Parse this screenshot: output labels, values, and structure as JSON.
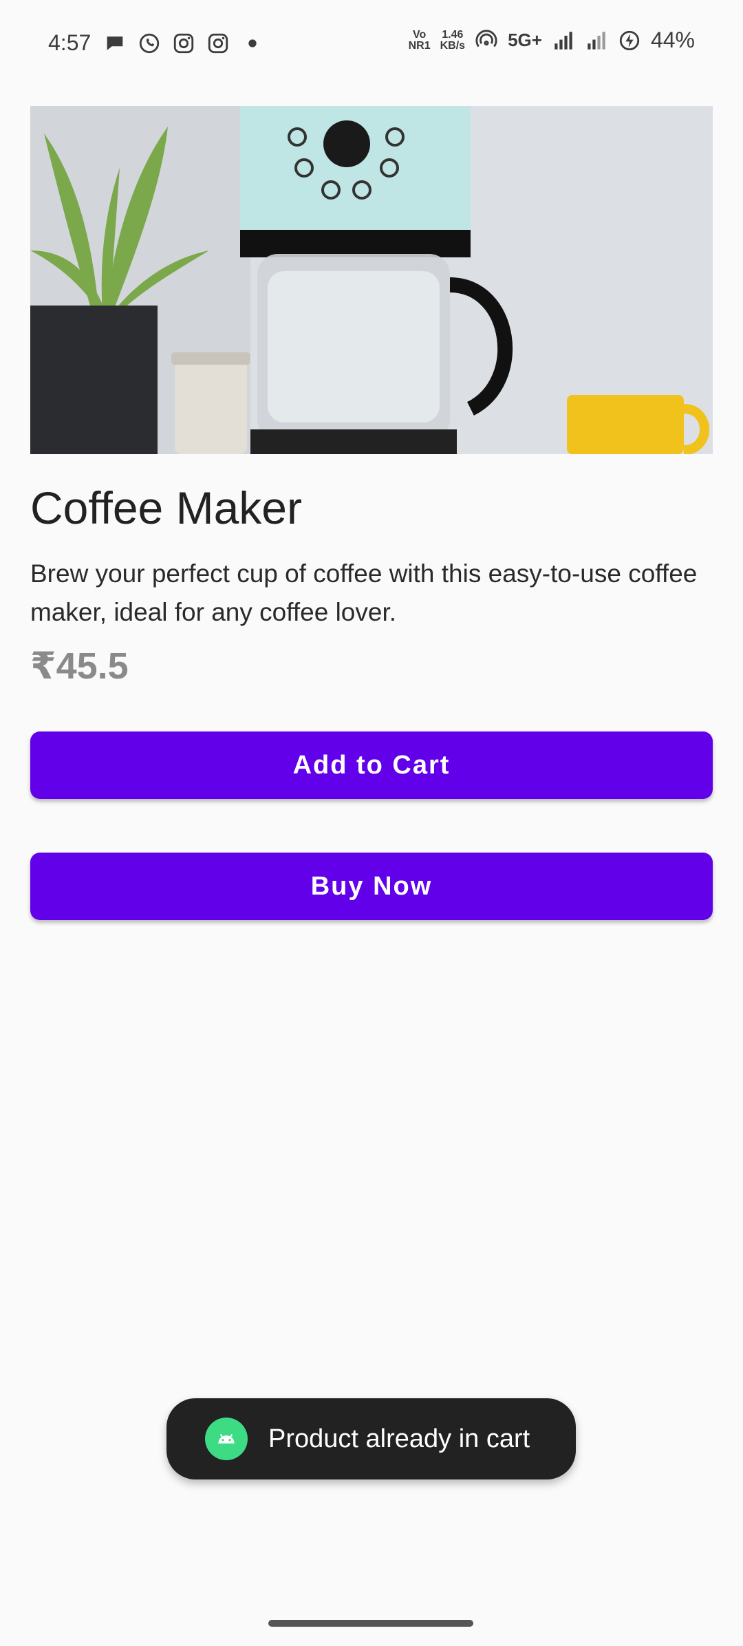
{
  "status_bar": {
    "time": "4:57",
    "left_icons": [
      "chat-bubble-icon",
      "whatsapp-icon",
      "instagram-icon",
      "instagram-icon",
      "dot-icon"
    ],
    "volte_top": "Vo",
    "volte_bottom": "NR1",
    "speed_top": "1.46",
    "speed_bottom": "KB/s",
    "network": "5G+",
    "battery_percent": "44%"
  },
  "product": {
    "image_icon": "coffee-maker-photo",
    "title": "Coffee Maker",
    "description": "Brew your perfect cup of coffee with this easy-to-use coffee maker, ideal for any coffee lover.",
    "price": "₹45.5"
  },
  "actions": {
    "add_to_cart": "Add to Cart",
    "buy_now": "Buy Now"
  },
  "toast": {
    "message": "Product already in cart",
    "icon": "android-icon"
  },
  "colors": {
    "accent": "#6200ea",
    "toast_bg": "#222222",
    "android_green": "#3ddc84",
    "price_text": "#8a8a8a"
  }
}
